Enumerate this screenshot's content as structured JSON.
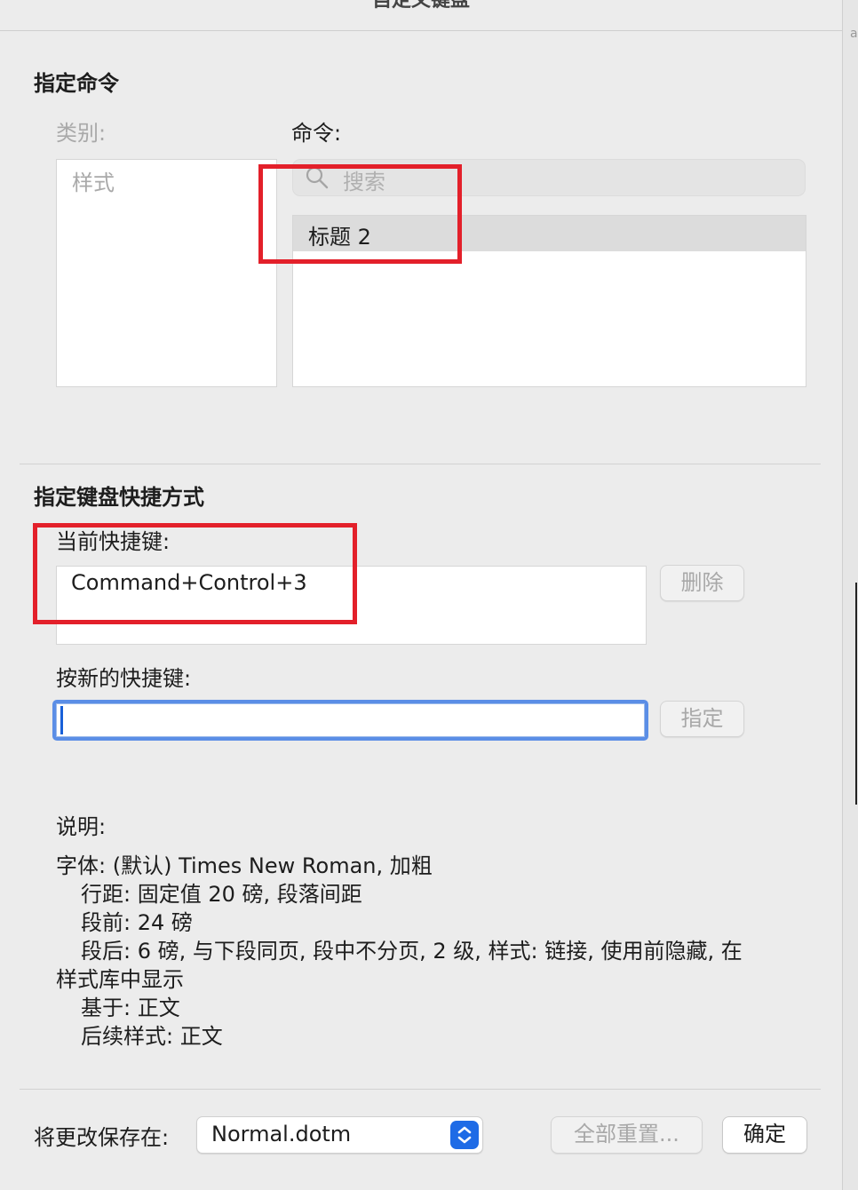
{
  "dialog": {
    "title": "自定义键盘"
  },
  "assign_command": {
    "heading": "指定命令",
    "categories_label": "类别:",
    "categories": [
      "样式"
    ],
    "commands_label": "命令:",
    "search_placeholder": "搜索",
    "commands": [
      "标题 2"
    ]
  },
  "shortcut": {
    "heading": "指定键盘快捷方式",
    "current_label": "当前快捷键:",
    "current_keys": [
      "Command+Control+3"
    ],
    "delete_button": "删除",
    "new_label": "按新的快捷键:",
    "new_value": "",
    "assign_button": "指定"
  },
  "description": {
    "label": "说明:",
    "lines": [
      "字体: (默认) Times New Roman, 加粗",
      "行距: 固定值 20 磅, 段落间距",
      "段前: 24 磅",
      "段后: 6 磅, 与下段同页, 段中不分页, 2 级, 样式: 链接, 使用前隐藏, 在",
      "样式库中显示",
      "基于: 正文",
      "后续样式: 正文"
    ]
  },
  "footer": {
    "save_label": "将更改保存在:",
    "save_target": "Normal.dotm",
    "reset_all_button": "全部重置...",
    "ok_button": "确定"
  },
  "edge": {
    "right_char": "a"
  },
  "colors": {
    "highlight_box": "#e3202a",
    "focus_ring": "#5b8ee6",
    "stepper": "#1e6be6"
  }
}
